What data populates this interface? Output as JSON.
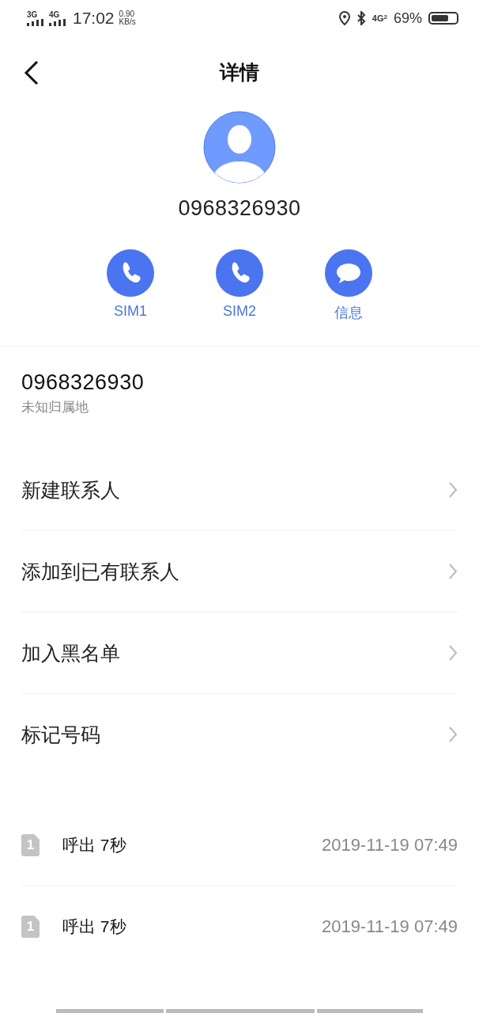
{
  "status_bar": {
    "signal_1": "3G",
    "signal_2": "4G",
    "time": "17:02",
    "speed_value": "0.90",
    "speed_unit": "KB/s",
    "network": "4G",
    "network_sub": "2",
    "battery": {
      "text": "69%"
    }
  },
  "header": {
    "title": "详情"
  },
  "contact": {
    "number": "0968326930"
  },
  "actions": [
    {
      "kind": "call",
      "label": "SIM1"
    },
    {
      "kind": "call",
      "label": "SIM2"
    },
    {
      "kind": "message",
      "label": "信息"
    }
  ],
  "number_info": {
    "number": "0968326930",
    "location": "未知归属地"
  },
  "menu": [
    "新建联系人",
    "添加到已有联系人",
    "加入黑名单",
    "标记号码"
  ],
  "call_log": [
    {
      "sim": "1",
      "type": "呼出 7秒",
      "time": "2019-11-19 07:49"
    },
    {
      "sim": "1",
      "type": "呼出 7秒",
      "time": "2019-11-19 07:49"
    }
  ]
}
